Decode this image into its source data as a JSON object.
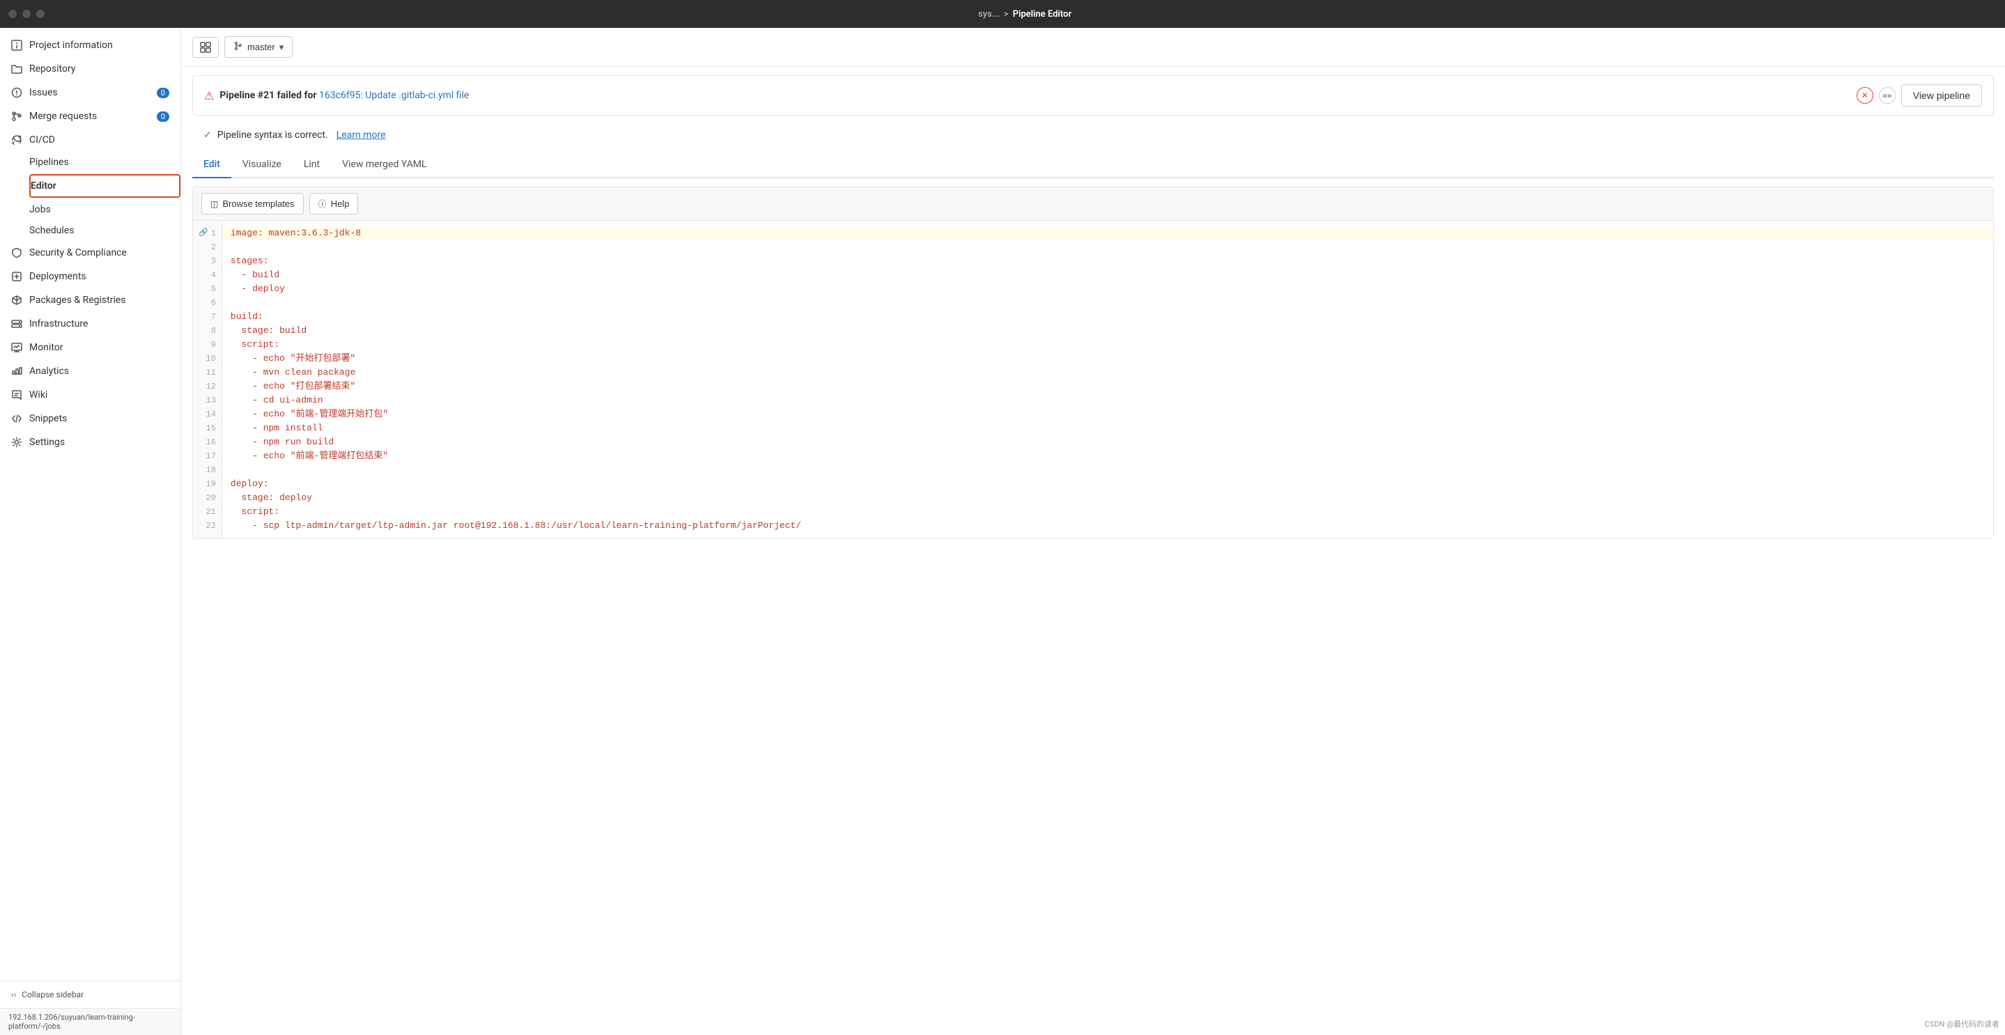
{
  "topbar": {
    "breadcrumb_prefix": "sys...",
    "breadcrumb_separator": ">",
    "breadcrumb_current": "Pipeline Editor"
  },
  "sidebar": {
    "items": [
      {
        "id": "project-information",
        "label": "Project information",
        "icon": "info-icon",
        "badge": null
      },
      {
        "id": "repository",
        "label": "Repository",
        "icon": "folder-icon",
        "badge": null
      },
      {
        "id": "issues",
        "label": "Issues",
        "icon": "issues-icon",
        "badge": "0"
      },
      {
        "id": "merge-requests",
        "label": "Merge requests",
        "icon": "merge-icon",
        "badge": "0"
      },
      {
        "id": "cicd",
        "label": "CI/CD",
        "icon": "cicd-icon",
        "badge": null,
        "type": "section"
      }
    ],
    "cicd_subitems": [
      {
        "id": "pipelines",
        "label": "Pipelines"
      },
      {
        "id": "editor",
        "label": "Editor",
        "active": true
      },
      {
        "id": "jobs",
        "label": "Jobs"
      },
      {
        "id": "schedules",
        "label": "Schedules"
      }
    ],
    "bottom_items": [
      {
        "id": "security-compliance",
        "label": "Security & Compliance",
        "icon": "shield-icon"
      },
      {
        "id": "deployments",
        "label": "Deployments",
        "icon": "deploy-icon"
      },
      {
        "id": "packages-registries",
        "label": "Packages & Registries",
        "icon": "package-icon"
      },
      {
        "id": "infrastructure",
        "label": "Infrastructure",
        "icon": "infra-icon"
      },
      {
        "id": "monitor",
        "label": "Monitor",
        "icon": "monitor-icon"
      },
      {
        "id": "analytics",
        "label": "Analytics",
        "icon": "analytics-icon"
      },
      {
        "id": "wiki",
        "label": "Wiki",
        "icon": "wiki-icon"
      },
      {
        "id": "snippets",
        "label": "Snippets",
        "icon": "snippets-icon"
      },
      {
        "id": "settings",
        "label": "Settings",
        "icon": "settings-icon"
      }
    ],
    "collapse_label": "Collapse sidebar",
    "url": "192.168.1.206/suyuan/learn-training-platform/-/jobs"
  },
  "toolbar": {
    "branch": "master"
  },
  "alert": {
    "text": "Pipeline #21 failed for ",
    "link_text": "163c6f95: Update .gitlab-ci.yml file",
    "link_href": "#"
  },
  "success": {
    "text": "Pipeline syntax is correct.",
    "link_text": "Learn more",
    "link_href": "#"
  },
  "tabs": [
    {
      "id": "edit",
      "label": "Edit",
      "active": true
    },
    {
      "id": "visualize",
      "label": "Visualize",
      "active": false
    },
    {
      "id": "lint",
      "label": "Lint",
      "active": false
    },
    {
      "id": "view-merged-yaml",
      "label": "View merged YAML",
      "active": false
    }
  ],
  "code_toolbar": {
    "browse_label": "Browse templates",
    "help_label": "Help"
  },
  "code_lines": [
    {
      "num": 1,
      "content": "image: maven:3.6.3-jdk-8",
      "highlighted": true,
      "has_anchor": true
    },
    {
      "num": 2,
      "content": "",
      "highlighted": false
    },
    {
      "num": 3,
      "content": "stages:",
      "highlighted": false
    },
    {
      "num": 4,
      "content": "  - build",
      "highlighted": false
    },
    {
      "num": 5,
      "content": "  - deploy",
      "highlighted": false
    },
    {
      "num": 6,
      "content": "",
      "highlighted": false
    },
    {
      "num": 7,
      "content": "build:",
      "highlighted": false
    },
    {
      "num": 8,
      "content": "  stage: build",
      "highlighted": false
    },
    {
      "num": 9,
      "content": "  script:",
      "highlighted": false
    },
    {
      "num": 10,
      "content": "    - echo \"开始打包部署\"",
      "highlighted": false
    },
    {
      "num": 11,
      "content": "    - mvn clean package",
      "highlighted": false
    },
    {
      "num": 12,
      "content": "    - echo \"打包部署结束\"",
      "highlighted": false
    },
    {
      "num": 13,
      "content": "    - cd ui-admin",
      "highlighted": false
    },
    {
      "num": 14,
      "content": "    - echo \"前端-管理端开始打包\"",
      "highlighted": false
    },
    {
      "num": 15,
      "content": "    - npm install",
      "highlighted": false
    },
    {
      "num": 16,
      "content": "    - npm run build",
      "highlighted": false
    },
    {
      "num": 17,
      "content": "    - echo \"前端-管理端打包结束\"",
      "highlighted": false
    },
    {
      "num": 18,
      "content": "",
      "highlighted": false
    },
    {
      "num": 19,
      "content": "deploy:",
      "highlighted": false
    },
    {
      "num": 20,
      "content": "  stage: deploy",
      "highlighted": false
    },
    {
      "num": 21,
      "content": "  script:",
      "highlighted": false
    },
    {
      "num": 22,
      "content": "    - scp ltp-admin/target/ltp-admin.jar root@192.168.1.88:/usr/local/learn-training-platform/jarPorject/",
      "highlighted": false
    }
  ],
  "view_pipeline_label": "View pipeline",
  "csdn_badge": "CSDN @最代码的读者"
}
